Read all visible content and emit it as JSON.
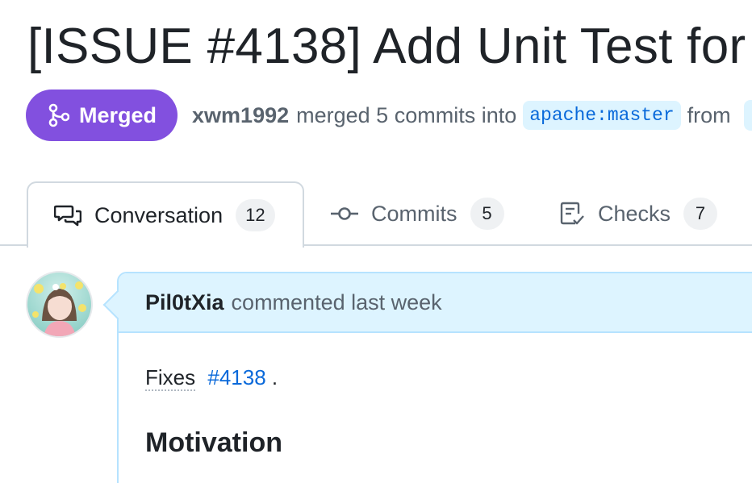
{
  "pr": {
    "title": "[ISSUE #4138] Add Unit Test for",
    "state_label": "Merged",
    "author": "xwm1992",
    "merge_text": "merged 5 commits into",
    "base_branch": "apache:master",
    "from_text": "from"
  },
  "tabs": [
    {
      "label": "Conversation",
      "count": "12",
      "icon": "comment-discussion-icon"
    },
    {
      "label": "Commits",
      "count": "5",
      "icon": "git-commit-icon"
    },
    {
      "label": "Checks",
      "count": "7",
      "icon": "checklist-icon"
    }
  ],
  "comment": {
    "author": "Pil0tXia",
    "action": "commented last week",
    "body": {
      "fixes_word": "Fixes",
      "issue_ref": "#4138",
      "trailing": ".",
      "heading": "Motivation"
    }
  },
  "colors": {
    "merged_purple": "#8250df",
    "link_blue": "#0969da",
    "header_blue_bg": "#ddf4ff",
    "header_blue_border": "#b6e3ff",
    "muted_text": "#59636e"
  }
}
